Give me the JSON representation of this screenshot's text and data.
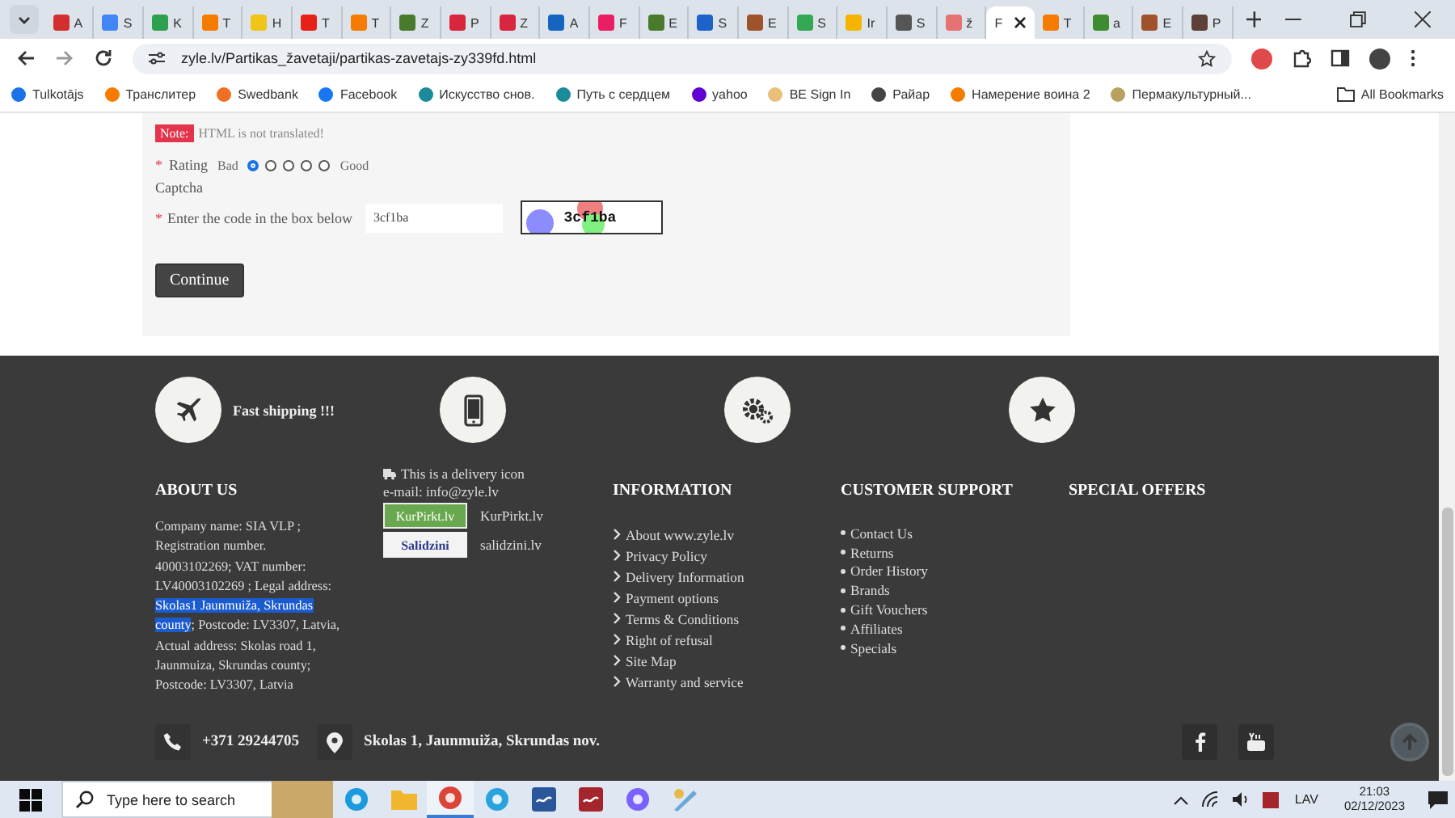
{
  "browser": {
    "tabs": [
      {
        "title": "A",
        "color": "#d32f2f",
        "selected": false
      },
      {
        "title": "S",
        "color": "#4285f4",
        "selected": false
      },
      {
        "title": "K",
        "color": "#2e9e4f",
        "selected": false
      },
      {
        "title": "T",
        "color": "#f57c00",
        "selected": false
      },
      {
        "title": "H",
        "color": "#f0c419",
        "selected": false
      },
      {
        "title": "T",
        "color": "#e62117",
        "selected": false
      },
      {
        "title": "T",
        "color": "#f57c00",
        "selected": false
      },
      {
        "title": "Z",
        "color": "#4a7a2c",
        "selected": false
      },
      {
        "title": "P",
        "color": "#d7263d",
        "selected": false
      },
      {
        "title": "Z",
        "color": "#d7263d",
        "selected": false
      },
      {
        "title": "A",
        "color": "#1565c0",
        "selected": false
      },
      {
        "title": "F",
        "color": "#e91e63",
        "selected": false
      },
      {
        "title": "E",
        "color": "#4a7a2c",
        "selected": false
      },
      {
        "title": "S",
        "color": "#1e63c9",
        "selected": false
      },
      {
        "title": "E",
        "color": "#a0522d",
        "selected": false
      },
      {
        "title": "S",
        "color": "#34a853",
        "selected": false
      },
      {
        "title": "Ir",
        "color": "#f4b400",
        "selected": false
      },
      {
        "title": "S",
        "color": "#555555",
        "selected": false
      },
      {
        "title": "ž",
        "color": "#e57373",
        "selected": false
      },
      {
        "title": "F",
        "selected": true
      },
      {
        "title": "T",
        "color": "#f57c00",
        "selected": false
      },
      {
        "title": "a",
        "color": "#3c8d2f",
        "selected": false
      },
      {
        "title": "E",
        "color": "#a0522d",
        "selected": false
      },
      {
        "title": "P",
        "color": "#5d4037",
        "selected": false
      }
    ],
    "address": "zyle.lv/Partikas_žavetaji/partikas-zavetajs-zy339fd.html",
    "bookmarks": [
      {
        "label": "Tulkotājs",
        "color": "#1a73e8"
      },
      {
        "label": "Транслитер",
        "color": "#f57c00"
      },
      {
        "label": "Swedbank",
        "color": "#ee7023"
      },
      {
        "label": "Facebook",
        "color": "#1877f2"
      },
      {
        "label": "Искусство снов.",
        "color": "#1b8a9a"
      },
      {
        "label": "Путь с сердцем",
        "color": "#1b8a9a"
      },
      {
        "label": "yahoo",
        "color": "#6001d2"
      },
      {
        "label": "BE Sign In",
        "color": "#e8c07a"
      },
      {
        "label": "Райар",
        "color": "#444444"
      },
      {
        "label": "Намерение воина 2",
        "color": "#f57c00"
      },
      {
        "label": "Пермакультурный...",
        "color": "#b8a060"
      }
    ],
    "all_bookmarks": "All Bookmarks"
  },
  "form": {
    "note_badge": "Note:",
    "note": "HTML is not translated!",
    "rating": {
      "mark": "*",
      "label": "Rating",
      "low": "Bad",
      "high": "Good",
      "options": [
        {
          "selected": true
        },
        {
          "selected": false
        },
        {
          "selected": false
        },
        {
          "selected": false
        },
        {
          "selected": false
        }
      ]
    },
    "captcha_heading": "Captcha",
    "code": {
      "mark": "*",
      "label": "Enter the code in the box below",
      "value": "3cf1ba"
    },
    "captcha_image_text": "3cf1ba",
    "continue": "Continue"
  },
  "footer": {
    "features": [
      {
        "kind": "plane",
        "text": "Fast shipping !!!"
      },
      {
        "kind": "phone"
      },
      {
        "kind": "gears"
      },
      {
        "kind": "star"
      }
    ],
    "about": {
      "heading": "ABOUT US",
      "segments": [
        {
          "text": "Company name: SIA VLP ; Registration number. 40003102269; VAT number: LV40003102269 ; Legal address: ",
          "highlighted": false
        },
        {
          "text": "Skolas1 Jaunmuiža, Skrundas county",
          "highlighted": true
        },
        {
          "text": "; Postcode: LV3307, Latvia, Actual address: Skolas road 1, Jaunmuiza, Skrundas county; Postcode: LV3307, Latvia",
          "highlighted": false
        }
      ]
    },
    "delivery": "This is a delivery icon",
    "email": "e-mail: info@zyle.lv",
    "partners": [
      {
        "logo": "KurPirkt.lv",
        "kind": "kurpirkt",
        "label": "KurPirkt.lv"
      },
      {
        "logo": "Salidzini",
        "kind": "salidzini",
        "label": "salidzini.lv"
      }
    ],
    "information": {
      "heading": "INFORMATION",
      "links": [
        "About www.zyle.lv",
        "Privacy Policy",
        "Delivery Information",
        "Payment options",
        "Terms & Conditions",
        "Right of refusal",
        "Site Map",
        "Warranty and service"
      ]
    },
    "support": {
      "heading": "CUSTOMER SUPPORT",
      "links": [
        "Contact Us",
        "Returns",
        "Order History",
        "Brands",
        "Gift Vouchers",
        "Affiliates",
        "Specials"
      ]
    },
    "offers": {
      "heading": "SPECIAL OFFERS"
    },
    "phone": "+371 29244705",
    "location": "Skolas 1, Jaunmuiža, Skrundas nov."
  },
  "taskbar": {
    "search_placeholder": "Type here to search",
    "apps": [
      {
        "kind": "edge",
        "selected": false
      },
      {
        "kind": "folder",
        "selected": false
      },
      {
        "kind": "chrome",
        "selected": true
      },
      {
        "kind": "telegram",
        "selected": false
      },
      {
        "kind": "word",
        "selected": false
      },
      {
        "kind": "wave",
        "selected": false
      },
      {
        "kind": "copilot",
        "selected": false
      },
      {
        "kind": "paint",
        "selected": false
      }
    ],
    "language": "LAV",
    "time": "21:03",
    "date": "02/12/2023"
  }
}
